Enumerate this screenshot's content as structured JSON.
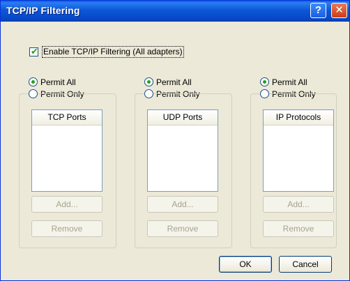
{
  "window": {
    "title": "TCP/IP Filtering",
    "help_glyph": "?",
    "close_glyph": "✕"
  },
  "enable_filtering": {
    "label": "Enable TCP/IP Filtering (All adapters)",
    "checked": true
  },
  "columns": [
    {
      "permit_all": "Permit All",
      "permit_only": "Permit Only",
      "list_header": "TCP Ports",
      "add": "Add...",
      "remove": "Remove"
    },
    {
      "permit_all": "Permit All",
      "permit_only": "Permit Only",
      "list_header": "UDP Ports",
      "add": "Add...",
      "remove": "Remove"
    },
    {
      "permit_all": "Permit All",
      "permit_only": "Permit Only",
      "list_header": "IP Protocols",
      "add": "Add...",
      "remove": "Remove"
    }
  ],
  "buttons": {
    "ok": "OK",
    "cancel": "Cancel"
  },
  "colors": {
    "title_bar": "#0b58d7",
    "dialog_bg": "#ece9d8",
    "radio_dot": "#21a121"
  }
}
